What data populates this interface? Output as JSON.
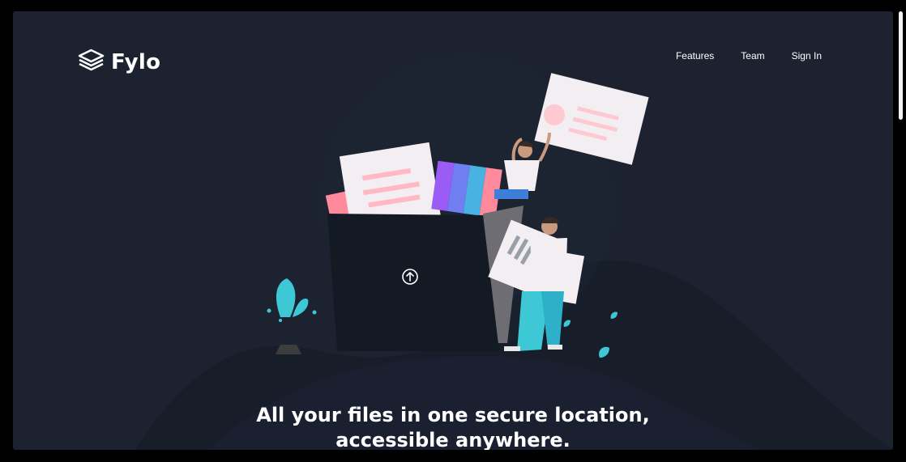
{
  "brand": {
    "name": "Fylo",
    "logo_icon": "stacked-layers-icon"
  },
  "nav": {
    "items": [
      "Features",
      "Team",
      "Sign In"
    ]
  },
  "hero": {
    "title_line1": "All your files in one secure location,",
    "title_line2": "accessible anywhere.",
    "illustration_icon": "upload-arrow-icon"
  },
  "colors": {
    "background": "#1c2230",
    "hill": "#181e29",
    "accent_teal": "#3ec8d6",
    "accent_blue": "#4f6dd7",
    "paper": "#f3eef2",
    "pink": "#ff8a9c",
    "text": "#ffffff"
  }
}
